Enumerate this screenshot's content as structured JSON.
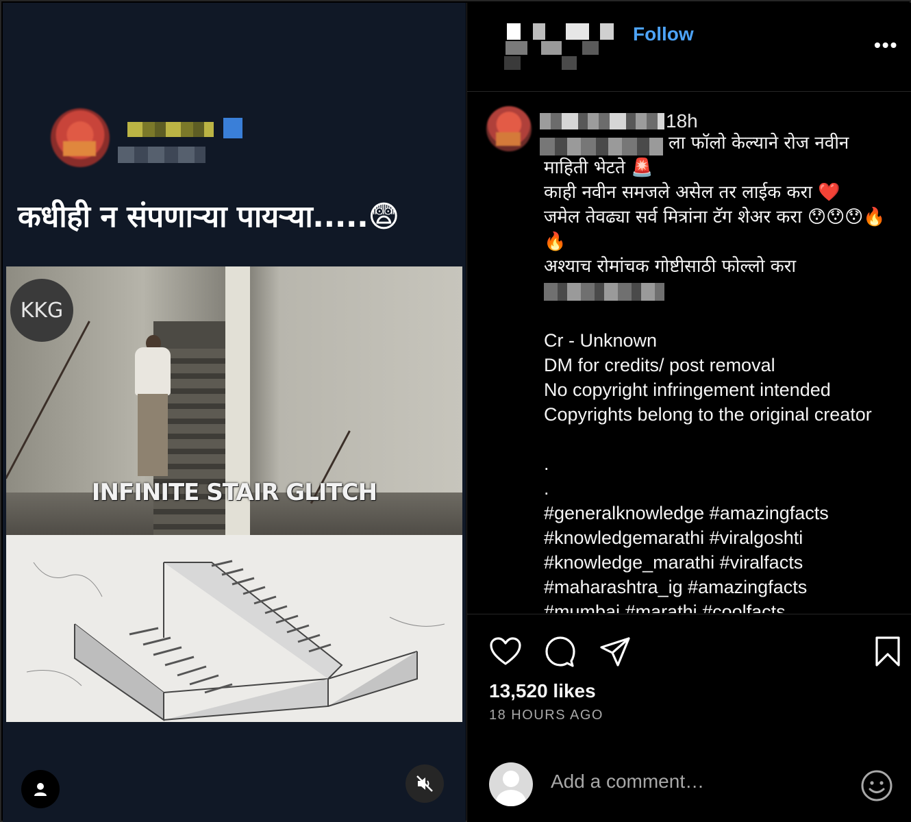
{
  "media": {
    "caption": "कधीही न संपणाऱ्या पायऱ्या.....😨",
    "video_logo": "KKG",
    "video_label": "INFINITE STAIR GLITCH"
  },
  "header": {
    "follow_label": "Follow",
    "more_label": "•••"
  },
  "post": {
    "timestamp": "18h",
    "caption_lines": [
      "ला फॉलो केल्याने रोज नवीन",
      "माहिती भेटते 🚨",
      "काही नवीन समजले असेल तर लाईक करा ❤️",
      "जमेल तेवढ्या सर्व मित्रांना टॅग शेअर करा 😯😯😯🔥",
      "🔥",
      "अश्याच रोमांचक गोष्टीसाठी फोल्लो करा"
    ],
    "credit_lines": [
      "Cr - Unknown",
      "DM for credits/ post removal",
      "No copyright infringement intended",
      "Copyrights belong to the original creator"
    ],
    "dots": [
      ".",
      "."
    ],
    "hashtag_lines": [
      "#generalknowledge #amazingfacts",
      "#knowledgemarathi #viralgoshti",
      "#knowledge_marathi #viralfacts",
      "#maharashtra_ig #amazingfacts",
      "#mumbai #marathi #coolfacts"
    ]
  },
  "stats": {
    "likes": "13,520 likes",
    "time_ago": "18 HOURS AGO"
  },
  "comment": {
    "placeholder": "Add a comment…"
  },
  "icons": {
    "like": "heart-icon",
    "comment": "comment-bubble-icon",
    "share": "paper-plane-icon",
    "save": "bookmark-icon",
    "emoji": "smiley-icon",
    "mute": "speaker-muted-icon",
    "tags": "person-icon"
  },
  "colors": {
    "follow": "#4da3f7",
    "background": "#000000",
    "media_background": "#101826"
  }
}
